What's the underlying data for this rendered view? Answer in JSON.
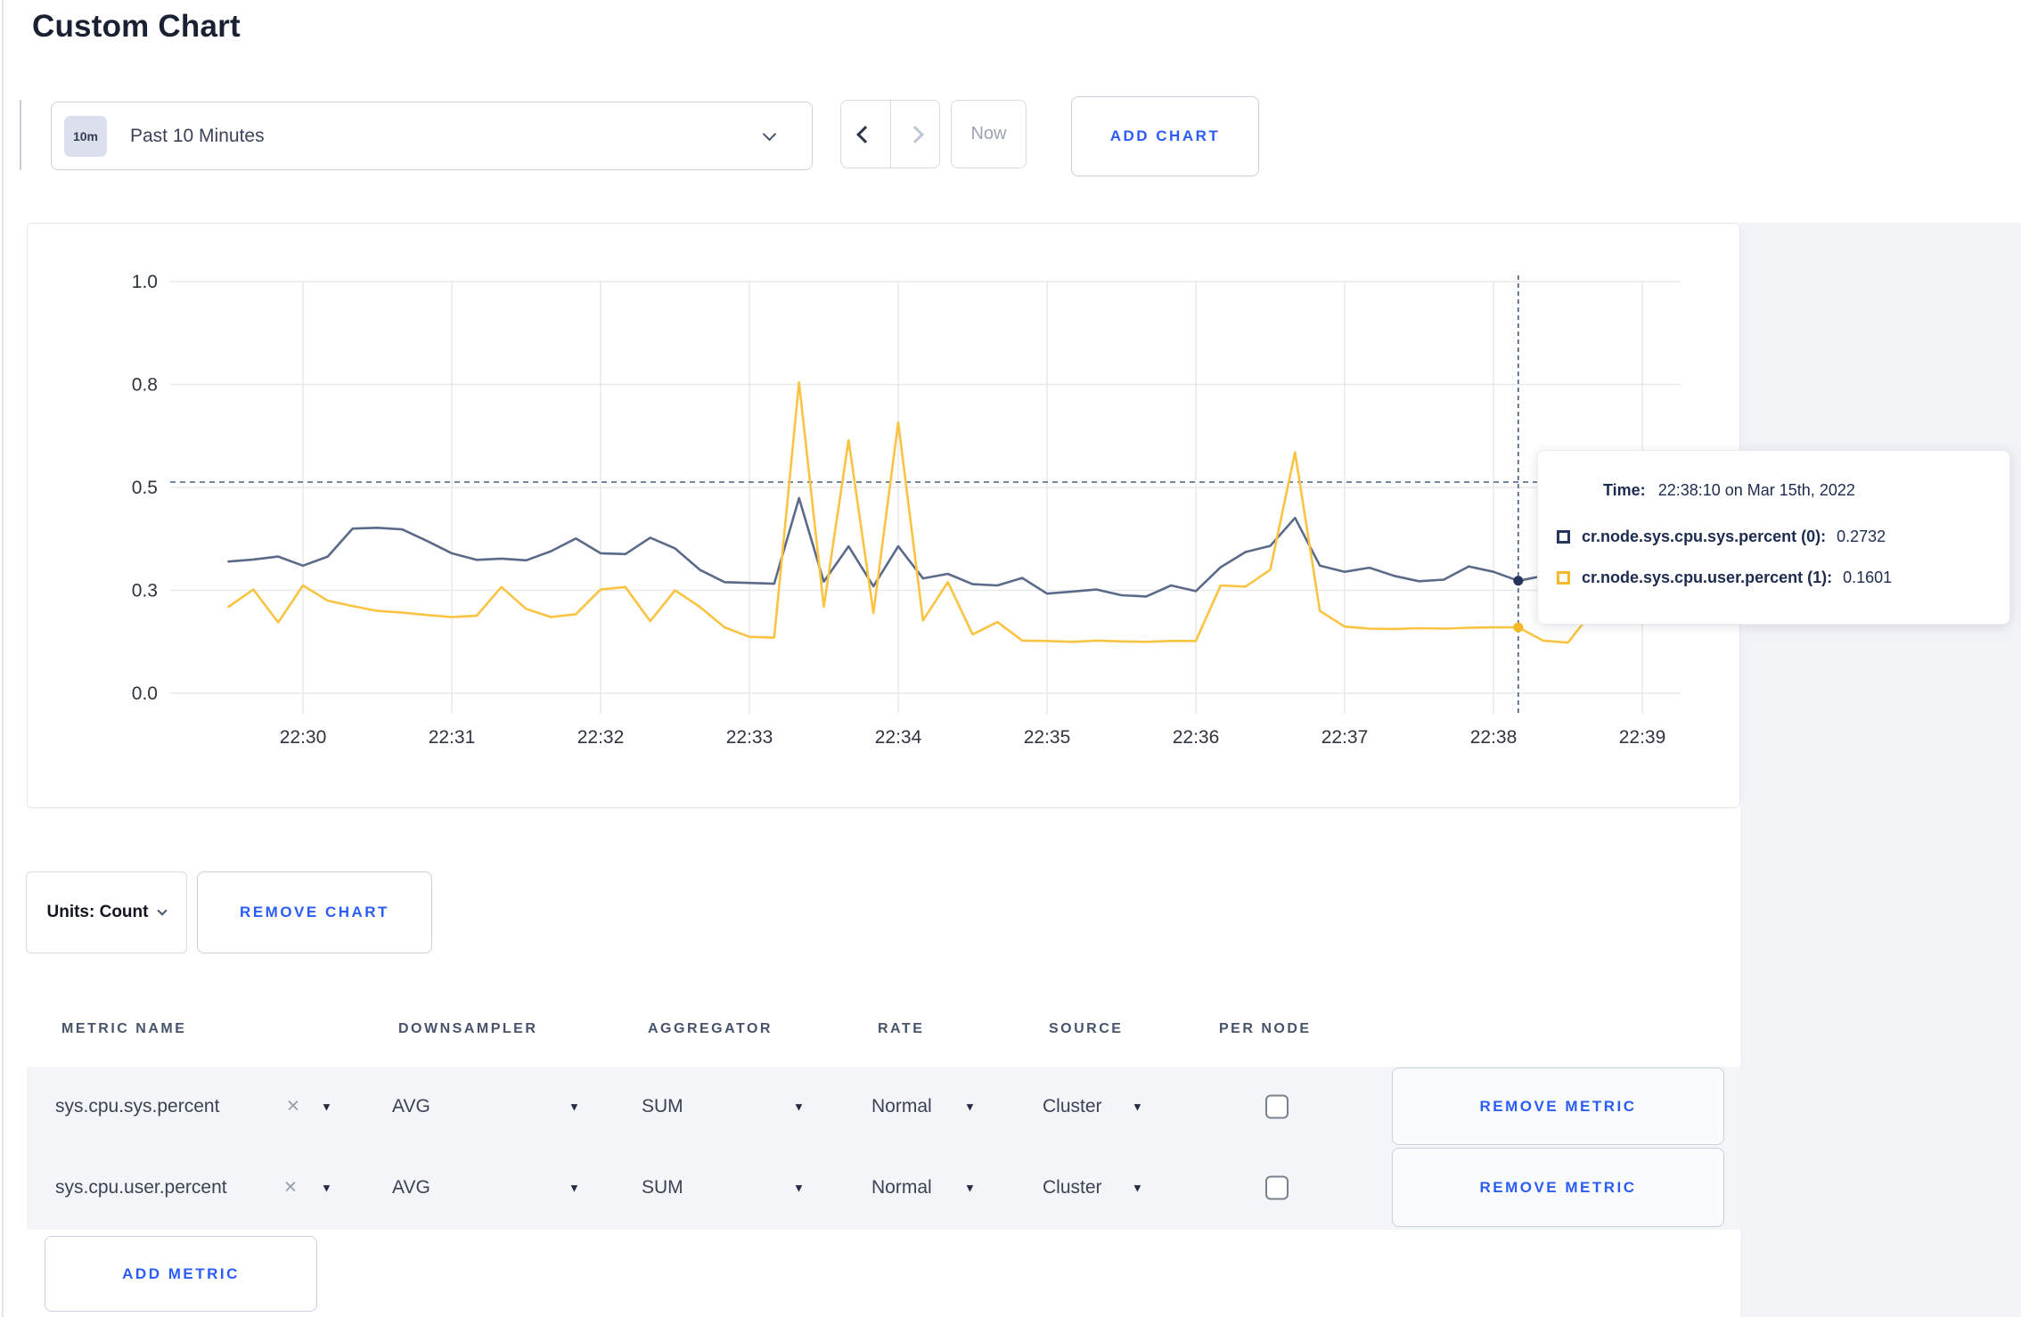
{
  "page": {
    "title": "Custom Chart"
  },
  "toolbar": {
    "range_badge": "10m",
    "range_label": "Past 10 Minutes",
    "now_label": "Now",
    "add_chart_label": "ADD CHART"
  },
  "colors": {
    "series_sys": "#5a6a88",
    "series_user": "#fbc342",
    "accent_blue": "#2b5cf6",
    "grid": "#e8e9ec",
    "axis_text": "#2e3440",
    "crosshair": "#46607a",
    "tooltip_swatch_sys": "#25355c",
    "tooltip_swatch_user": "#f5b928"
  },
  "chart_data": {
    "type": "line",
    "title": "",
    "xlabel": "",
    "ylabel": "",
    "ylim": [
      0,
      1
    ],
    "grid": true,
    "x_tick_labels": [
      "22:30",
      "22:31",
      "22:32",
      "22:33",
      "22:34",
      "22:35",
      "22:36",
      "22:37",
      "22:38",
      "22:39"
    ],
    "y_tick_values": [
      0,
      0.25,
      0.5,
      0.75,
      1.0
    ],
    "y_tick_labels": [
      "0.0",
      "0.3",
      "0.5",
      "0.8",
      "1.0"
    ],
    "x_start": "22:29:30",
    "x_step_seconds": 10,
    "series": [
      {
        "name": "cr.node.sys.cpu.sys.percent",
        "color": "#5a6a88",
        "values": [
          0.32,
          0.325,
          0.332,
          0.31,
          0.332,
          0.4,
          0.402,
          0.398,
          0.37,
          0.34,
          0.324,
          0.327,
          0.323,
          0.345,
          0.376,
          0.34,
          0.338,
          0.378,
          0.352,
          0.3,
          0.27,
          0.268,
          0.266,
          0.474,
          0.271,
          0.357,
          0.26,
          0.357,
          0.279,
          0.29,
          0.265,
          0.262,
          0.28,
          0.242,
          0.247,
          0.252,
          0.238,
          0.235,
          0.262,
          0.248,
          0.306,
          0.343,
          0.358,
          0.426,
          0.31,
          0.295,
          0.305,
          0.285,
          0.272,
          0.276,
          0.308,
          0.295,
          0.2732,
          0.285,
          0.3,
          0.315,
          0.3,
          0.295,
          0.31
        ]
      },
      {
        "name": "cr.node.sys.cpu.user.percent",
        "color": "#fbc342",
        "values": [
          0.21,
          0.252,
          0.172,
          0.262,
          0.225,
          0.212,
          0.2,
          0.196,
          0.19,
          0.185,
          0.188,
          0.258,
          0.205,
          0.185,
          0.192,
          0.252,
          0.258,
          0.175,
          0.25,
          0.21,
          0.16,
          0.137,
          0.135,
          0.755,
          0.21,
          0.615,
          0.195,
          0.658,
          0.177,
          0.27,
          0.143,
          0.173,
          0.128,
          0.127,
          0.125,
          0.128,
          0.126,
          0.125,
          0.127,
          0.127,
          0.262,
          0.259,
          0.3,
          0.585,
          0.2,
          0.162,
          0.157,
          0.156,
          0.158,
          0.157,
          0.159,
          0.16,
          0.1601,
          0.128,
          0.123,
          0.199,
          0.28,
          0.168,
          0.255
        ]
      }
    ],
    "legend_position": "tooltip-overlay",
    "crosshair": {
      "index": 52,
      "time": "22:38:10",
      "hline_value": 0.513,
      "dot_values": [
        0.2732,
        0.1601
      ]
    },
    "tooltip": {
      "time_label": "Time:",
      "time_value": "22:38:10 on Mar 15th, 2022",
      "rows": [
        {
          "label": "cr.node.sys.cpu.sys.percent (0):",
          "value": "0.2732"
        },
        {
          "label": "cr.node.sys.cpu.user.percent (1):",
          "value": "0.1601"
        }
      ]
    }
  },
  "units_row": {
    "units_label": "Units: Count",
    "remove_chart_label": "REMOVE CHART"
  },
  "metrics_table": {
    "headers": [
      "METRIC NAME",
      "DOWNSAMPLER",
      "AGGREGATOR",
      "RATE",
      "SOURCE",
      "PER NODE"
    ],
    "rows": [
      {
        "metric": "sys.cpu.sys.percent",
        "downsampler": "AVG",
        "aggregator": "SUM",
        "rate": "Normal",
        "source": "Cluster",
        "per_node": false,
        "remove_label": "REMOVE METRIC"
      },
      {
        "metric": "sys.cpu.user.percent",
        "downsampler": "AVG",
        "aggregator": "SUM",
        "rate": "Normal",
        "source": "Cluster",
        "per_node": false,
        "remove_label": "REMOVE METRIC"
      }
    ],
    "add_metric_label": "ADD METRIC"
  }
}
